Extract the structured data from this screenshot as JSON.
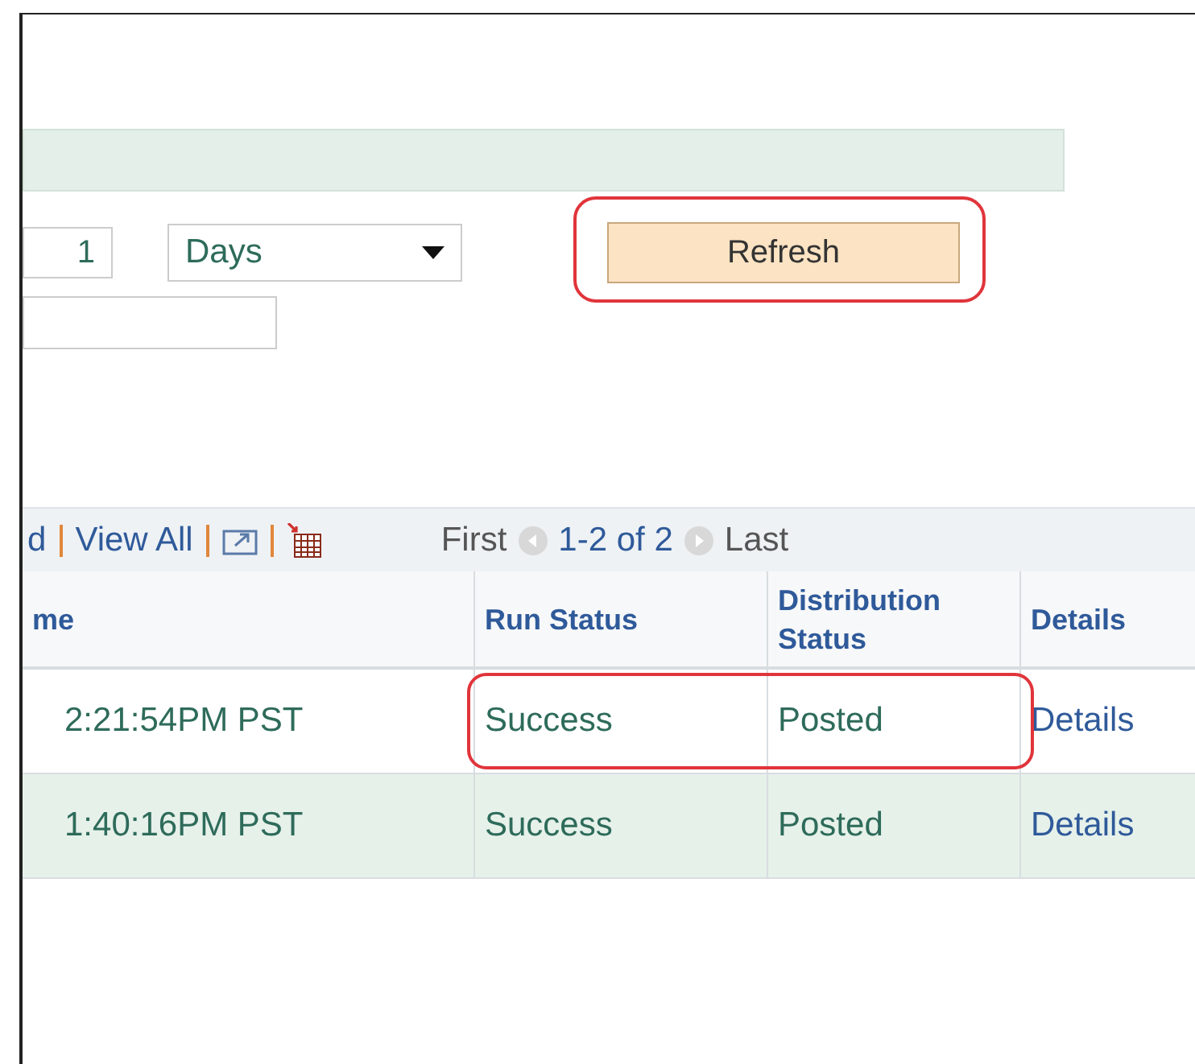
{
  "number_field": {
    "value": "1"
  },
  "unit_select": {
    "value": "Days"
  },
  "refresh_button": {
    "label": "Refresh",
    "highlighted": true
  },
  "grid_toolbar": {
    "find_link": "d",
    "view_all_link": "View All",
    "first": "First",
    "range": "1-2 of 2",
    "last": "Last"
  },
  "table": {
    "columns": [
      "me",
      "Run Status",
      "Distribution Status",
      "Details"
    ],
    "rows": [
      {
        "time": "2:21:54PM PST",
        "run_status": "Success",
        "distribution_status": "Posted",
        "details": "Details",
        "highlighted": true
      },
      {
        "time": "1:40:16PM PST",
        "run_status": "Success",
        "distribution_status": "Posted",
        "details": "Details",
        "highlighted": false
      }
    ]
  }
}
